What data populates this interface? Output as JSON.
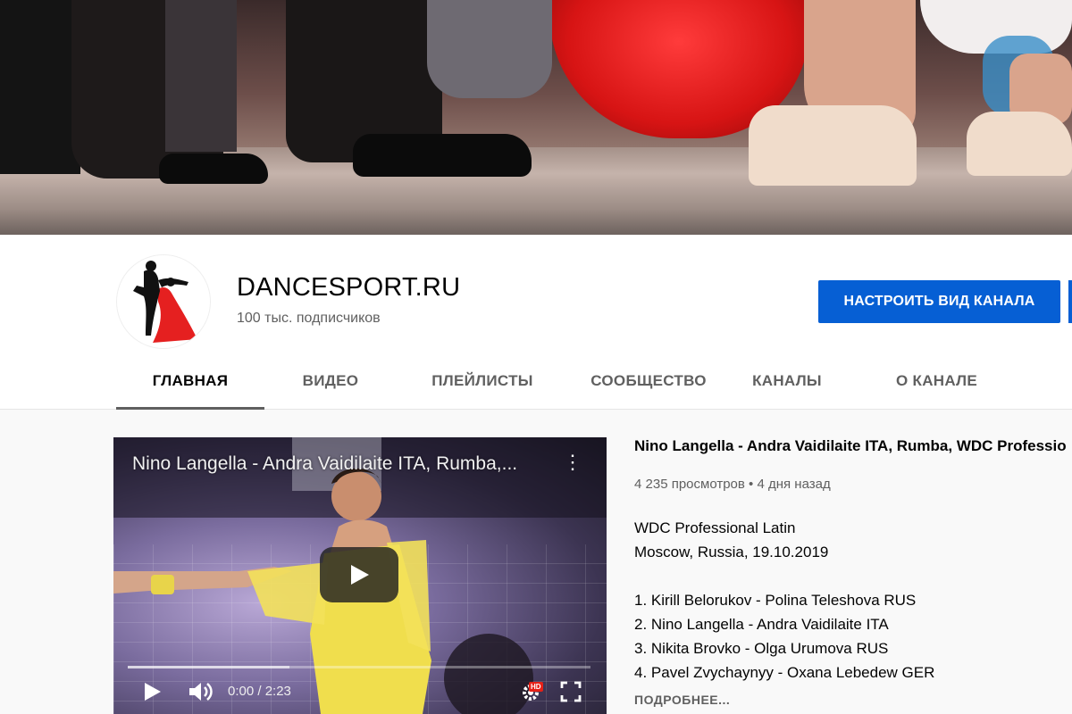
{
  "channel": {
    "name": "DANCESPORT.RU",
    "subscribers": "100 тыс. подписчиков",
    "customize_label": "НАСТРОИТЬ ВИД КАНАЛА"
  },
  "tabs": [
    {
      "label": "ГЛАВНАЯ",
      "active": true
    },
    {
      "label": "ВИДЕО",
      "active": false
    },
    {
      "label": "ПЛЕЙЛИСТЫ",
      "active": false
    },
    {
      "label": "СООБЩЕСТВО",
      "active": false
    },
    {
      "label": "КАНАЛЫ",
      "active": false
    },
    {
      "label": "О КАНАЛЕ",
      "active": false
    }
  ],
  "player": {
    "title": "Nino Langella - Andra Vaidilaite ITA, Rumba,...",
    "time": "0:00 / 2:23",
    "hd_badge": "HD",
    "progress_buffered_fraction": 0.35
  },
  "video": {
    "title": "Nino Langella - Andra Vaidilaite ITA, Rumba, WDC Professio",
    "meta": "4 235 просмотров • 4 дня назад",
    "description": [
      "WDC Professional Latin",
      "Moscow, Russia, 19.10.2019",
      "",
      "1. Kirill Belorukov - Polina Teleshova RUS",
      "2. Nino Langella - Andra Vaidilaite ITA",
      "3. Nikita Brovko - Olga Urumova RUS",
      "4. Pavel Zvychaynyy - Oxana Lebedew GER"
    ],
    "more_label": "ПОДРОБНЕЕ..."
  },
  "colors": {
    "accent": "#065fd4",
    "tab_underline": "#606060",
    "background": "#f9f9f9"
  }
}
